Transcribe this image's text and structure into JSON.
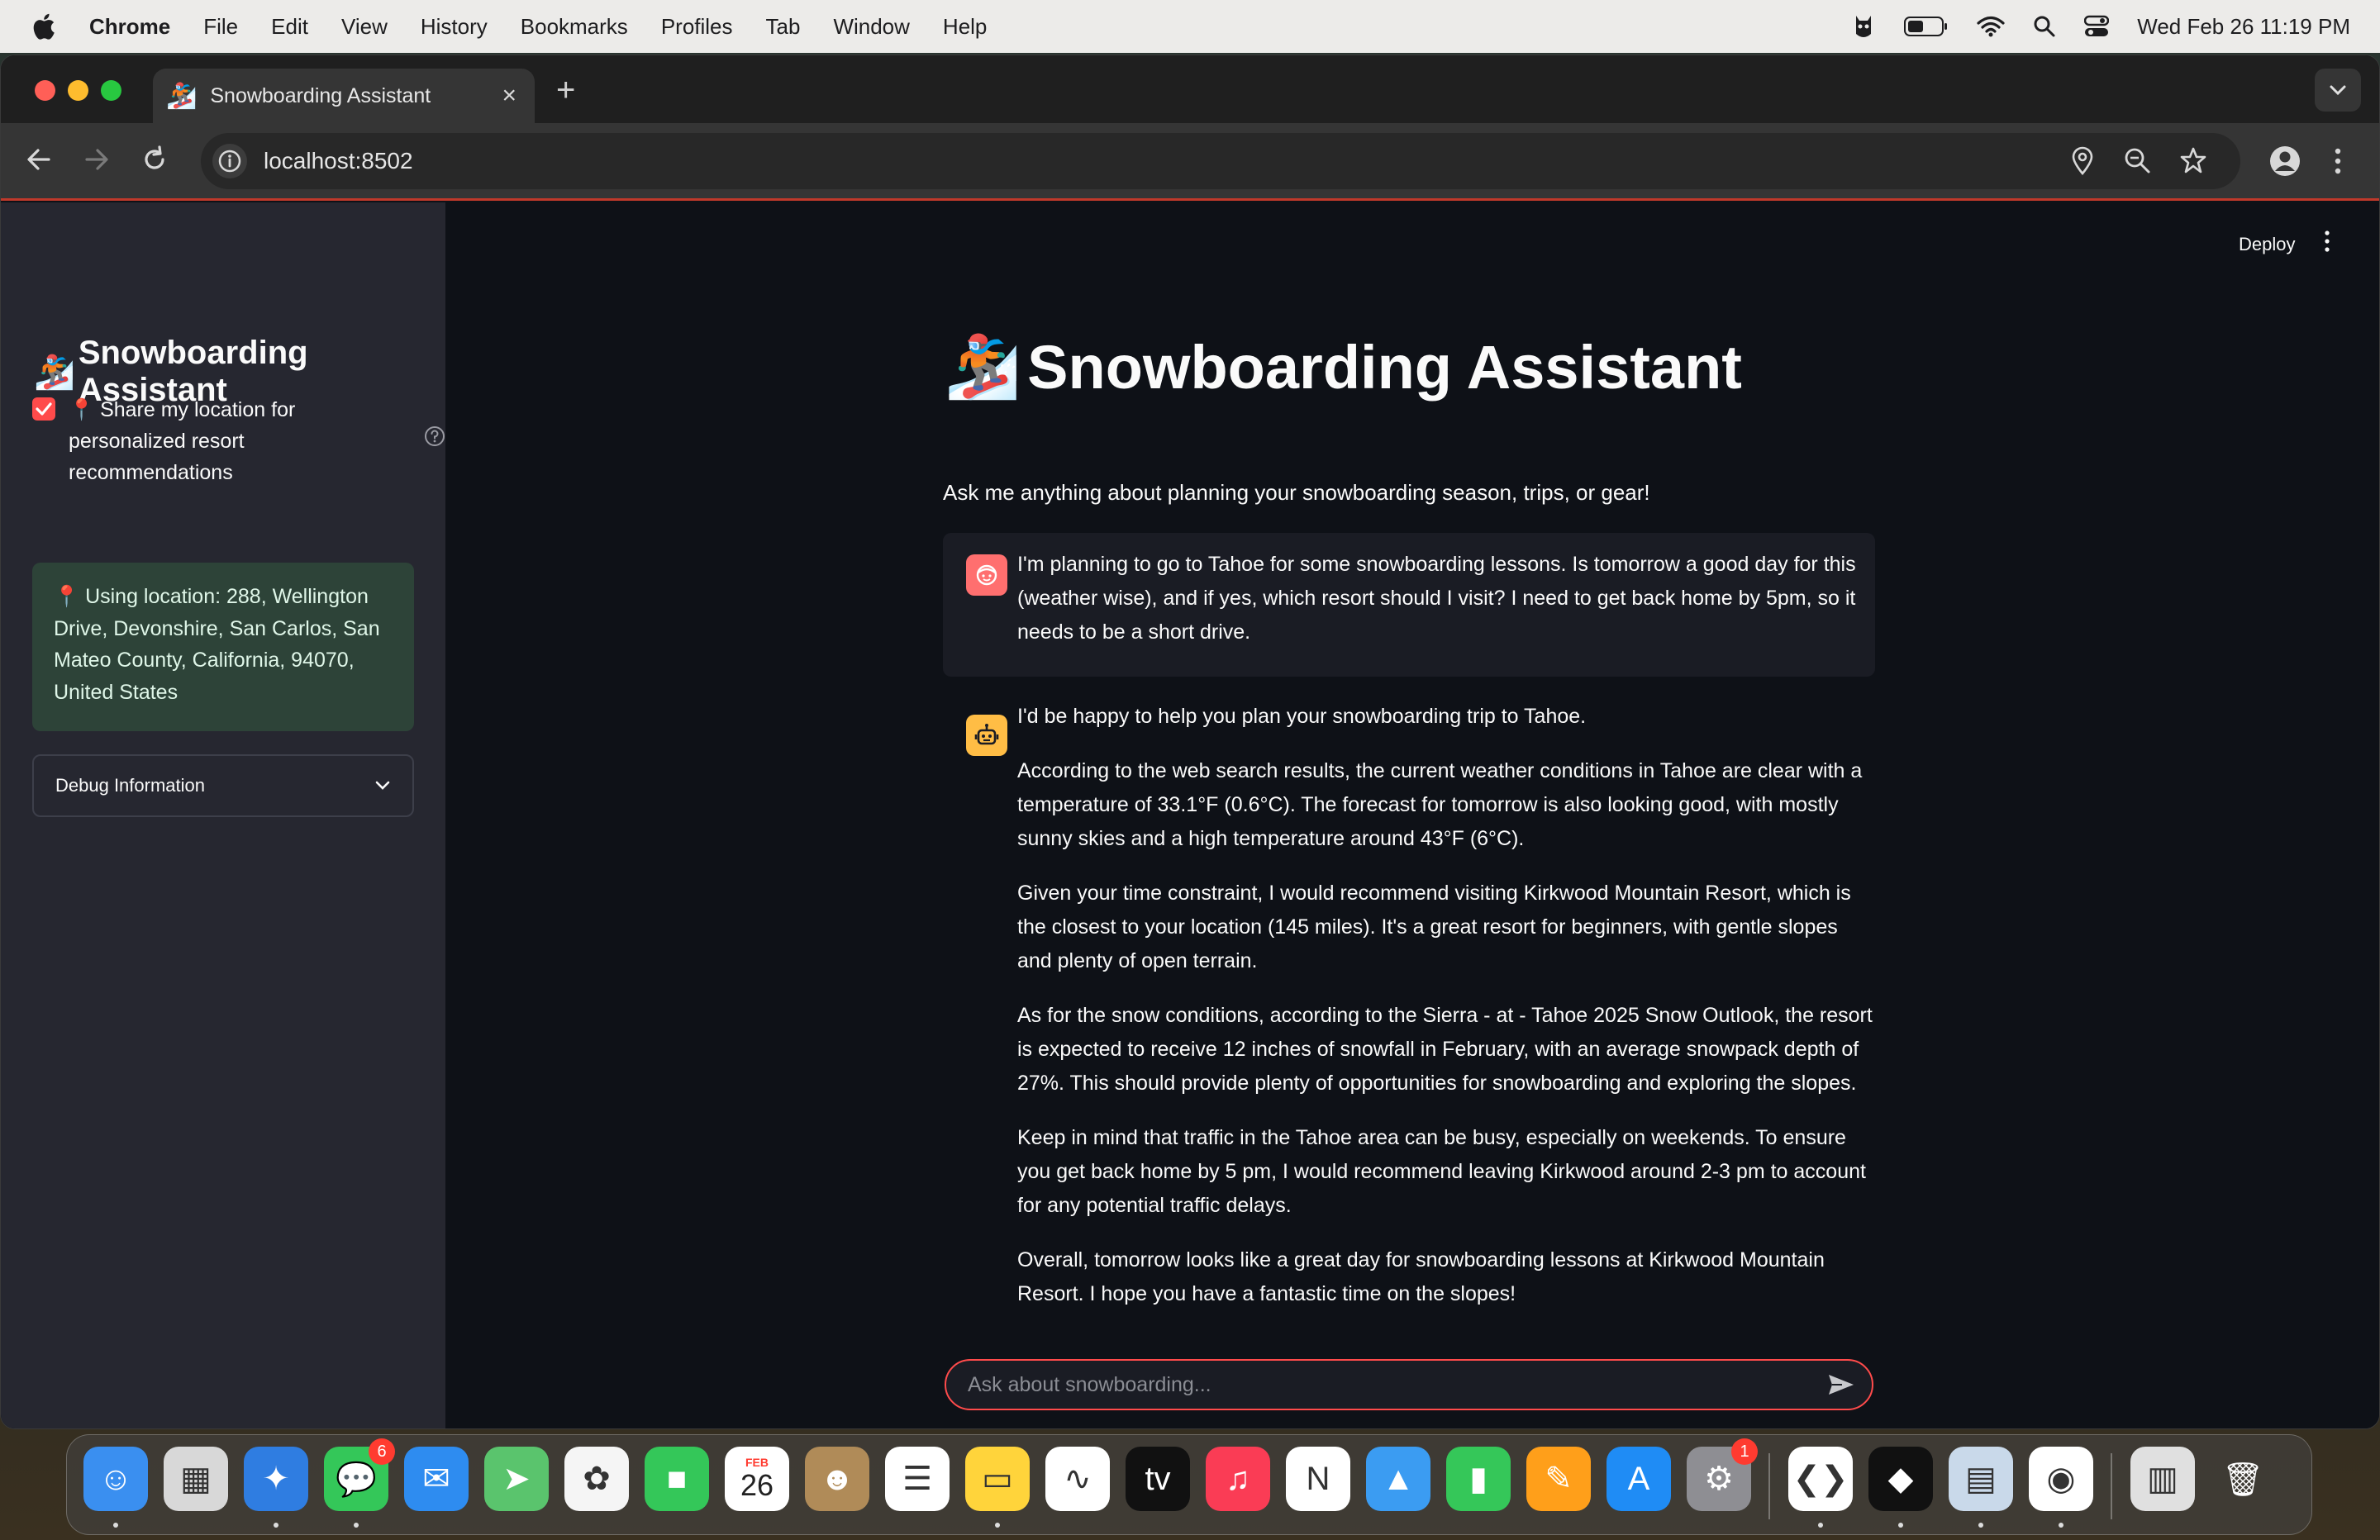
{
  "menubar": {
    "app_name": "Chrome",
    "items": [
      "File",
      "Edit",
      "View",
      "History",
      "Bookmarks",
      "Profiles",
      "Tab",
      "Window",
      "Help"
    ],
    "datetime": "Wed Feb 26  11:19 PM"
  },
  "browser": {
    "tab_title": "Snowboarding Assistant",
    "tab_favicon": "🏂",
    "url": "localhost:8502",
    "accent_color": "#c0392b"
  },
  "sidebar": {
    "title": "Snowboarding Assistant",
    "title_icon": "🏂",
    "checkbox_checked": true,
    "checkbox_label": "📍 Share my location for personalized resort recommendations",
    "location_text": "📍 Using location: 288, Wellington Drive, Devonshire, San Carlos, San Mateo County, California, 94070, United States",
    "debug_label": "Debug Information"
  },
  "header": {
    "deploy_label": "Deploy"
  },
  "main": {
    "title": "Snowboarding Assistant",
    "title_icon": "🏂",
    "subtitle": "Ask me anything about planning your snowboarding season, trips, or gear!",
    "messages": [
      {
        "role": "user",
        "text": "I'm planning to go to Tahoe for some snowboarding lessons. Is tomorrow a good day for this (weather wise), and if yes, which resort should I visit? I need to get back home by 5pm, so it needs to be a short drive."
      },
      {
        "role": "assistant",
        "paragraphs": [
          "I'd be happy to help you plan your snowboarding trip to Tahoe.",
          "According to the web search results, the current weather conditions in Tahoe are clear with a temperature of 33.1°F (0.6°C). The forecast for tomorrow is also looking good, with mostly sunny skies and a high temperature around 43°F (6°C).",
          "Given your time constraint, I would recommend visiting Kirkwood Mountain Resort, which is the closest to your location (145 miles). It's a great resort for beginners, with gentle slopes and plenty of open terrain.",
          "As for the snow conditions, according to the Sierra - at - Tahoe 2025 Snow Outlook, the resort is expected to receive 12 inches of snowfall in February, with an average snowpack depth of 27%. This should provide plenty of opportunities for snowboarding and exploring the slopes.",
          "Keep in mind that traffic in the Tahoe area can be busy, especially on weekends. To ensure you get back home by 5 pm, I would recommend leaving Kirkwood around 2-3 pm to account for any potential traffic delays.",
          "Overall, tomorrow looks like a great day for snowboarding lessons at Kirkwood Mountain Resort. I hope you have a fantastic time on the slopes!"
        ]
      }
    ],
    "input_placeholder": "Ask about snowboarding...",
    "input_value": ""
  },
  "dock": {
    "items": [
      {
        "name": "finder-icon",
        "glyph": "☺",
        "bg": "#3a8ff0",
        "running": true
      },
      {
        "name": "launchpad-icon",
        "glyph": "▦",
        "bg": "#d8d8d8",
        "running": false
      },
      {
        "name": "safari-icon",
        "glyph": "✦",
        "bg": "#2f7de1",
        "running": true
      },
      {
        "name": "messages-icon",
        "glyph": "💬",
        "bg": "#34c759",
        "running": true,
        "badge": "6"
      },
      {
        "name": "mail-icon",
        "glyph": "✉",
        "bg": "#2e8cf0",
        "running": false
      },
      {
        "name": "maps-icon",
        "glyph": "➤",
        "bg": "#5ac46d",
        "running": false
      },
      {
        "name": "photos-icon",
        "glyph": "✿",
        "bg": "#f5f5f5",
        "running": false
      },
      {
        "name": "facetime-icon",
        "glyph": "■",
        "bg": "#34c759",
        "running": false
      },
      {
        "name": "calendar-icon",
        "glyph": "26",
        "bg": "#ffffff",
        "running": false,
        "month": "FEB"
      },
      {
        "name": "contacts-icon",
        "glyph": "☻",
        "bg": "#b08b58",
        "running": false
      },
      {
        "name": "reminders-icon",
        "glyph": "☰",
        "bg": "#ffffff",
        "running": false
      },
      {
        "name": "notes-icon",
        "glyph": "▭",
        "bg": "#ffd43b",
        "running": true
      },
      {
        "name": "freeform-icon",
        "glyph": "∿",
        "bg": "#ffffff",
        "running": false
      },
      {
        "name": "tv-icon",
        "glyph": "tv",
        "bg": "#111111",
        "running": false
      },
      {
        "name": "music-icon",
        "glyph": "♫",
        "bg": "#fa3c55",
        "running": false
      },
      {
        "name": "news-icon",
        "glyph": "N",
        "bg": "#ffffff",
        "running": false
      },
      {
        "name": "keynote-icon",
        "glyph": "▲",
        "bg": "#3b9cf2",
        "running": false
      },
      {
        "name": "numbers-icon",
        "glyph": "▮",
        "bg": "#35c759",
        "running": false
      },
      {
        "name": "pages-icon",
        "glyph": "✎",
        "bg": "#ff9f1a",
        "running": false
      },
      {
        "name": "app-store-icon",
        "glyph": "A",
        "bg": "#1f8cf5",
        "running": false
      },
      {
        "name": "system-settings-icon",
        "glyph": "⚙",
        "bg": "#8e8e93",
        "running": false,
        "badge": "1"
      },
      {
        "name": "vscode-icon",
        "glyph": "❮❯",
        "bg": "#ffffff",
        "running": true
      },
      {
        "name": "cursor-icon",
        "glyph": "◆",
        "bg": "#111111",
        "running": true
      },
      {
        "name": "preview-icon",
        "glyph": "▤",
        "bg": "#c9d9ea",
        "running": true
      },
      {
        "name": "chrome-icon",
        "glyph": "◉",
        "bg": "#ffffff",
        "running": true
      },
      {
        "name": "downloads-icon",
        "glyph": "▥",
        "bg": "#e0e0e0",
        "running": false
      },
      {
        "name": "trash-icon",
        "glyph": "🗑",
        "bg": "transparent",
        "running": false
      }
    ]
  }
}
